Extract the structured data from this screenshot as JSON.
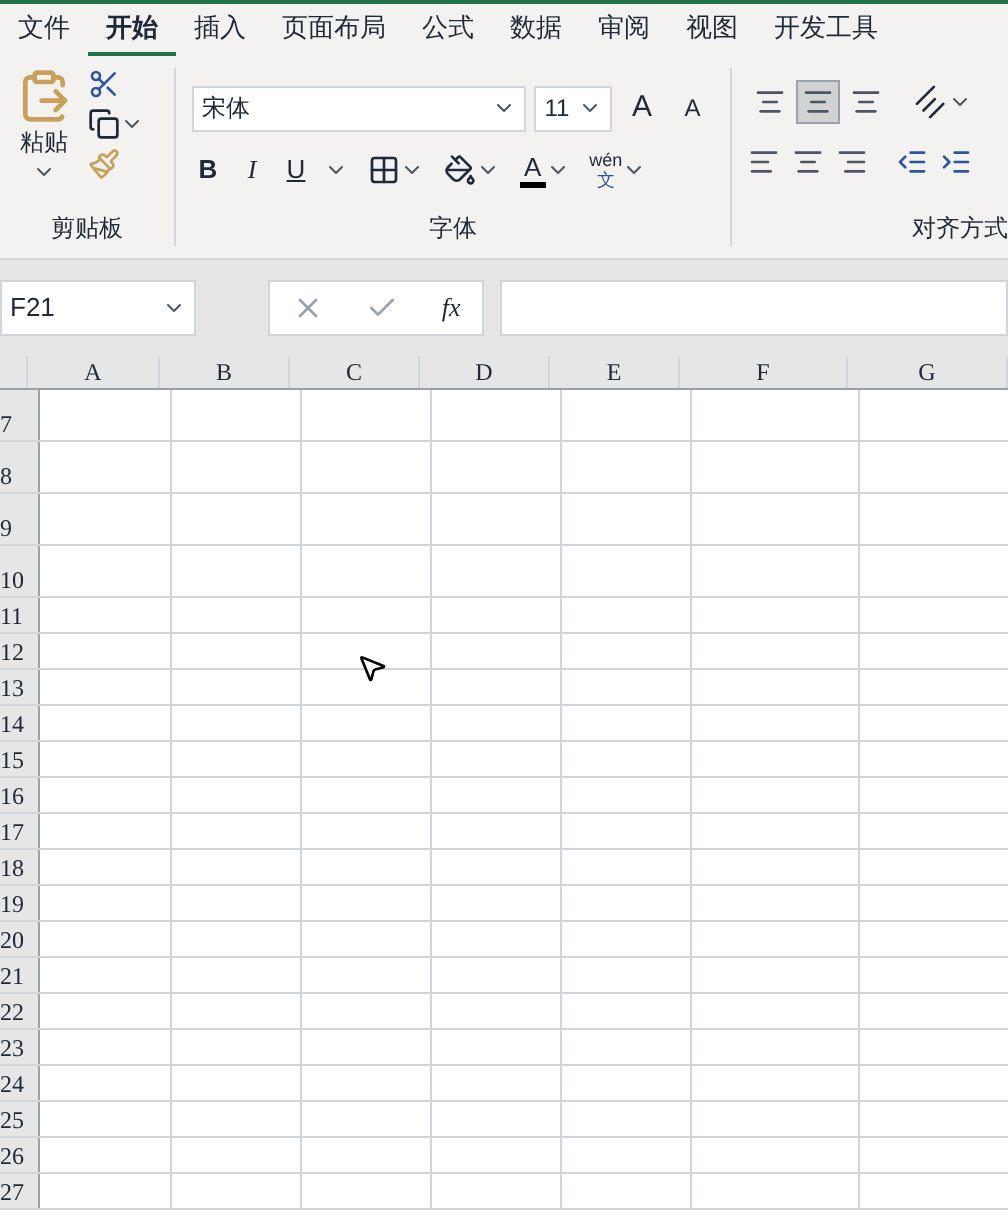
{
  "tabs": [
    {
      "label": "文件",
      "selected": false
    },
    {
      "label": "开始",
      "selected": true
    },
    {
      "label": "插入",
      "selected": false
    },
    {
      "label": "页面布局",
      "selected": false
    },
    {
      "label": "公式",
      "selected": false
    },
    {
      "label": "数据",
      "selected": false
    },
    {
      "label": "审阅",
      "selected": false
    },
    {
      "label": "视图",
      "selected": false
    },
    {
      "label": "开发工具",
      "selected": false
    }
  ],
  "clipboard": {
    "paste_label": "粘贴",
    "group_label": "剪贴板"
  },
  "font": {
    "name": "宋体",
    "size": "11",
    "grow_label": "A",
    "shrink_label": "A",
    "bold_label": "B",
    "italic_label": "I",
    "underline_label": "U",
    "color_label": "A",
    "phonetic_top": "wén",
    "phonetic_bottom": "文",
    "group_label": "字体"
  },
  "alignment": {
    "group_label": "对齐方式",
    "vertical": [
      {
        "selected": false
      },
      {
        "selected": true
      },
      {
        "selected": false
      }
    ]
  },
  "formula_bar": {
    "name_box": "F21",
    "fx_label": "fx"
  },
  "columns": [
    "A",
    "B",
    "C",
    "D",
    "E",
    "F",
    "G"
  ],
  "rows": [
    "7",
    "8",
    "9",
    "10",
    "11",
    "12",
    "13",
    "14",
    "15",
    "16",
    "17",
    "18",
    "19",
    "20",
    "21",
    "22",
    "23",
    "24",
    "25",
    "26",
    "27"
  ]
}
